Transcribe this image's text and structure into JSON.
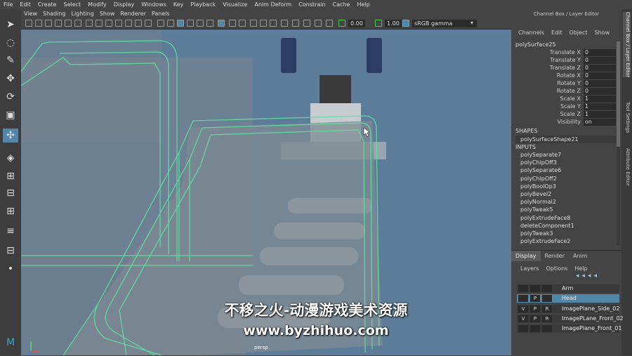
{
  "menubar": [
    "File",
    "Edit",
    "Create",
    "Select",
    "Modify",
    "Display",
    "Windows",
    "Key",
    "Playback",
    "Visualize",
    "Anim Deform",
    "Constrain",
    "Cache",
    "Help"
  ],
  "viewport": {
    "menu": [
      "View",
      "Shading",
      "Lighting",
      "Show",
      "Renderer",
      "Panels"
    ],
    "exposure": "0.00",
    "gamma": "1.00",
    "colorspace": "sRGB gamma",
    "camera_label": "persp"
  },
  "channel_box": {
    "title": "Channel Box / Layer Editor",
    "menu": [
      "Channels",
      "Edit",
      "Object",
      "Show"
    ],
    "object": "polySurface25",
    "attributes": [
      {
        "name": "Translate X",
        "value": "0"
      },
      {
        "name": "Translate Y",
        "value": "0"
      },
      {
        "name": "Translate Z",
        "value": "0"
      },
      {
        "name": "Rotate X",
        "value": "0"
      },
      {
        "name": "Rotate Y",
        "value": "0"
      },
      {
        "name": "Rotate Z",
        "value": "0"
      },
      {
        "name": "Scale X",
        "value": "1"
      },
      {
        "name": "Scale Y",
        "value": "1"
      },
      {
        "name": "Scale Z",
        "value": "1"
      },
      {
        "name": "Visibility",
        "value": "on"
      }
    ],
    "shapes_header": "SHAPES",
    "shape": "polySurfaceShape21",
    "inputs_header": "INPUTS",
    "inputs": [
      "polySeparate7",
      "polyChipOff3",
      "polySeparate6",
      "polyChipOff2",
      "polyBoolOp3",
      "polyBevel2",
      "polyNormal2",
      "polyTweak5",
      "polyExtrudeFace8",
      "deleteComponent1",
      "polyTweak3",
      "polyExtrudeFace2"
    ]
  },
  "side_tabs": [
    "Channel Box / Layer Editor",
    "Tool Settings",
    "Attribute Editor"
  ],
  "layer_editor": {
    "tabs": [
      "Display",
      "Render",
      "Anim"
    ],
    "menu": [
      "Layers",
      "Options",
      "Help"
    ],
    "layers": [
      {
        "v": "",
        "p": "",
        "r": "",
        "name": "Arm",
        "selected": false
      },
      {
        "v": "",
        "p": "P",
        "r": "",
        "name": "Head",
        "selected": true
      },
      {
        "v": "V",
        "p": "P",
        "r": "R",
        "name": "ImagePlane_Side_02",
        "selected": false
      },
      {
        "v": "V",
        "p": "P",
        "r": "R",
        "name": "ImagePLane_Front_02",
        "selected": false
      },
      {
        "v": "",
        "p": "",
        "r": "",
        "name": "ImagePlane_Front_01",
        "selected": false
      }
    ]
  },
  "watermark": {
    "line1": "不移之火-动漫游戏美术资源",
    "line2": "www.byzhihuo.com"
  },
  "colors": {
    "accent": "#5285a6",
    "wire": "#5fe0a0",
    "viewport_bg": "#5d7c9a"
  }
}
